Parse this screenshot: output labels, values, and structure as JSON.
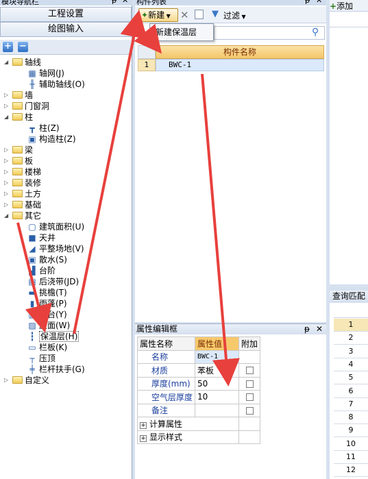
{
  "nav": {
    "title": "模块导航栏",
    "pin": "ᵽ",
    "close": "✕",
    "project_settings": "工程设置",
    "drawing_input": "绘图输入",
    "tree": [
      {
        "label": "轴线",
        "type": "folder",
        "open": true
      },
      {
        "label": "轴网(J)",
        "type": "item",
        "icon": "grid-icon"
      },
      {
        "label": "辅助轴线(O)",
        "type": "item",
        "icon": "aux-axis-icon"
      },
      {
        "label": "墙",
        "type": "folder",
        "open": false
      },
      {
        "label": "门窗洞",
        "type": "folder",
        "open": false
      },
      {
        "label": "柱",
        "type": "folder",
        "open": true
      },
      {
        "label": "柱(Z)",
        "type": "item",
        "icon": "column-icon"
      },
      {
        "label": "构造柱(Z)",
        "type": "item",
        "icon": "constructional-column-icon"
      },
      {
        "label": "梁",
        "type": "folder",
        "open": false
      },
      {
        "label": "板",
        "type": "folder",
        "open": false
      },
      {
        "label": "楼梯",
        "type": "folder",
        "open": false
      },
      {
        "label": "装修",
        "type": "folder",
        "open": false
      },
      {
        "label": "土方",
        "type": "folder",
        "open": false
      },
      {
        "label": "基础",
        "type": "folder",
        "open": false
      },
      {
        "label": "其它",
        "type": "folder",
        "open": true
      },
      {
        "label": "建筑面积(U)",
        "type": "item",
        "icon": "building-area-icon"
      },
      {
        "label": "天井",
        "type": "item",
        "icon": "patio-icon"
      },
      {
        "label": "平整场地(V)",
        "type": "item",
        "icon": "site-leveling-icon"
      },
      {
        "label": "散水(S)",
        "type": "item",
        "icon": "apron-icon"
      },
      {
        "label": "台阶",
        "type": "item",
        "icon": "steps-icon"
      },
      {
        "label": "后浇带(JD)",
        "type": "item",
        "icon": "post-pour-strip-icon"
      },
      {
        "label": "挑檐(T)",
        "type": "item",
        "icon": "eaves-icon"
      },
      {
        "label": "雨蓬(P)",
        "type": "item",
        "icon": "canopy-icon"
      },
      {
        "label": "阳台(Y)",
        "type": "item",
        "icon": "balcony-icon"
      },
      {
        "label": "屋面(W)",
        "type": "item",
        "icon": "roof-icon"
      },
      {
        "label": "保温层(H)",
        "type": "item",
        "icon": "insulation-icon",
        "selected": true
      },
      {
        "label": "栏板(K)",
        "type": "item",
        "icon": "parapet-icon"
      },
      {
        "label": "压顶",
        "type": "item",
        "icon": "coping-icon"
      },
      {
        "label": "栏杆扶手(G)",
        "type": "item",
        "icon": "railing-icon"
      },
      {
        "label": "自定义",
        "type": "folder",
        "open": false
      }
    ]
  },
  "list": {
    "title": "构件列表",
    "new_button": "新建",
    "filter_button": "过滤",
    "dropdown_item": "新建保温层",
    "column_header": "构件名称",
    "rows": [
      {
        "index": "1",
        "name": "BWC-1"
      }
    ]
  },
  "props": {
    "title": "属性编辑框",
    "headers": {
      "name": "属性名称",
      "value": "属性值",
      "extra": "附加"
    },
    "rows": [
      {
        "name": "名称",
        "value": "BWC-1",
        "checkbox": false
      },
      {
        "name": "材质",
        "value": "苯板",
        "checkbox": true
      },
      {
        "name": "厚度(mm)",
        "value": "50",
        "checkbox": true
      },
      {
        "name": "空气层厚度",
        "value": "10",
        "checkbox": true
      },
      {
        "name": "备注",
        "value": "",
        "checkbox": true
      }
    ],
    "groups": [
      "计算属性",
      "显示样式"
    ]
  },
  "right": {
    "add_label": "添加",
    "query_label": "查询匹配",
    "rows": [
      "1",
      "2",
      "3",
      "4",
      "5",
      "6",
      "7",
      "8",
      "9",
      "10",
      "11",
      "12"
    ]
  },
  "colors": {
    "accent": "#f6c96a",
    "selected_row": "#dbe9fb",
    "annotation_arrow": "#e8403c"
  }
}
